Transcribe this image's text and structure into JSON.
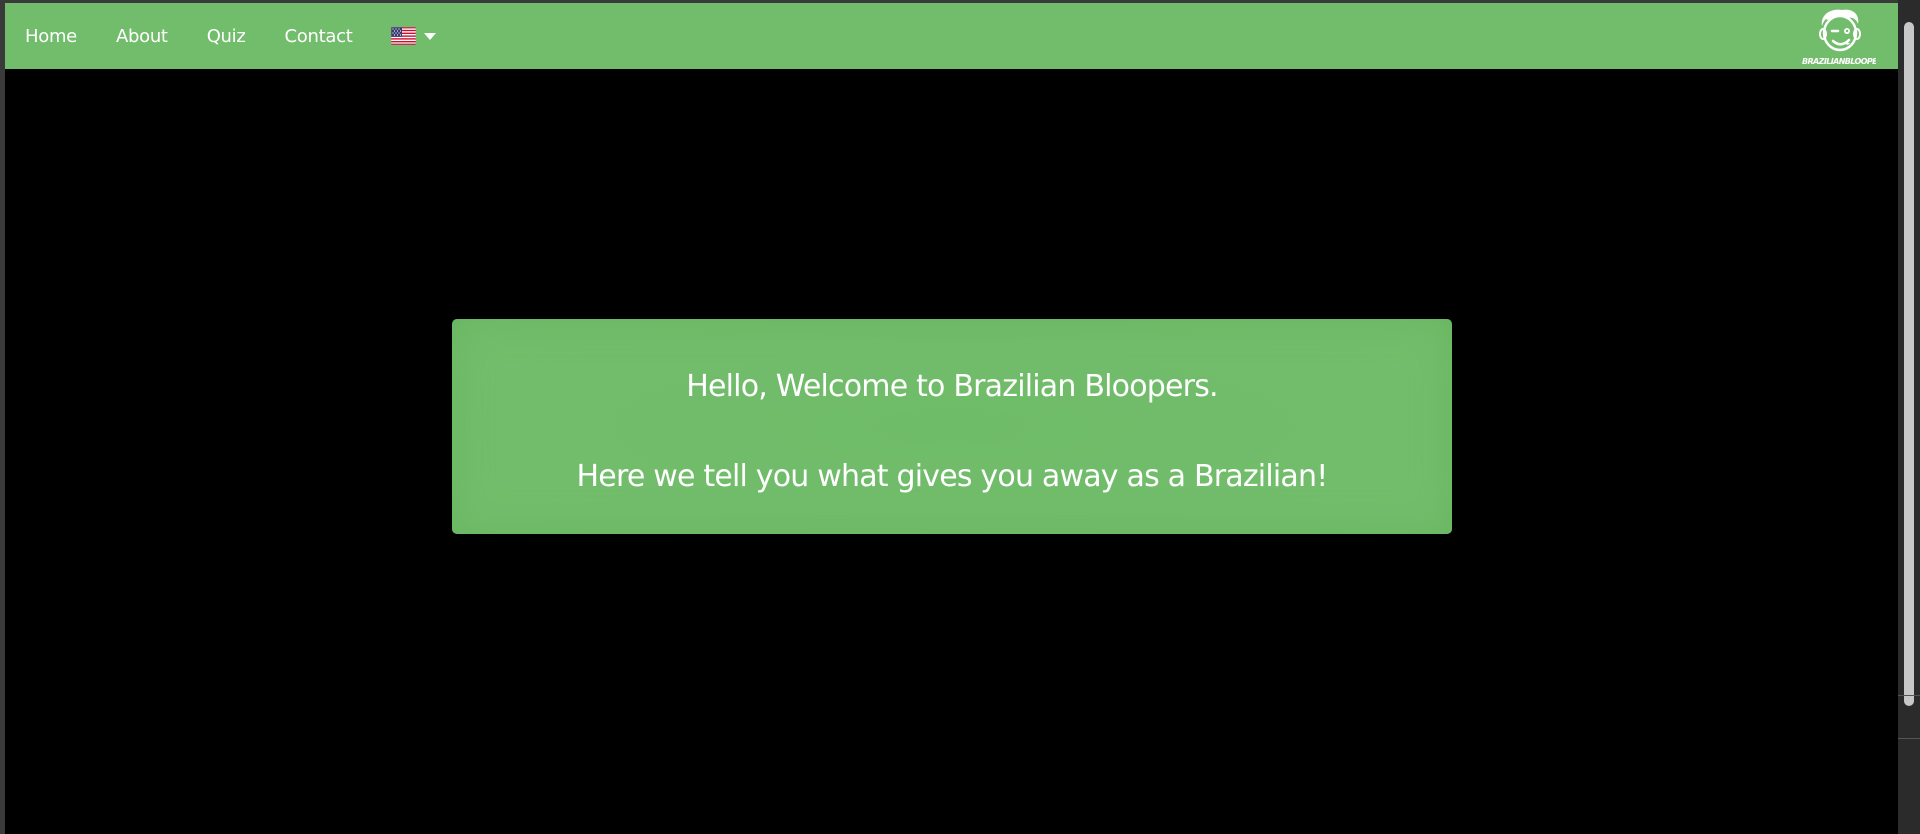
{
  "nav": {
    "items": [
      {
        "label": "Home"
      },
      {
        "label": "About"
      },
      {
        "label": "Quiz"
      },
      {
        "label": "Contact"
      }
    ],
    "language": {
      "flag": "us-flag-icon",
      "selected": "en-US"
    }
  },
  "logo": {
    "text": "BRAZILIANBLOOPERS"
  },
  "welcome": {
    "line1": "Hello, Welcome to Brazilian Bloopers.",
    "line2": "Here we tell you what gives you away as a Brazilian!"
  },
  "colors": {
    "brand_green": "#72bd6b",
    "background": "#000000",
    "text": "#ffffff"
  }
}
